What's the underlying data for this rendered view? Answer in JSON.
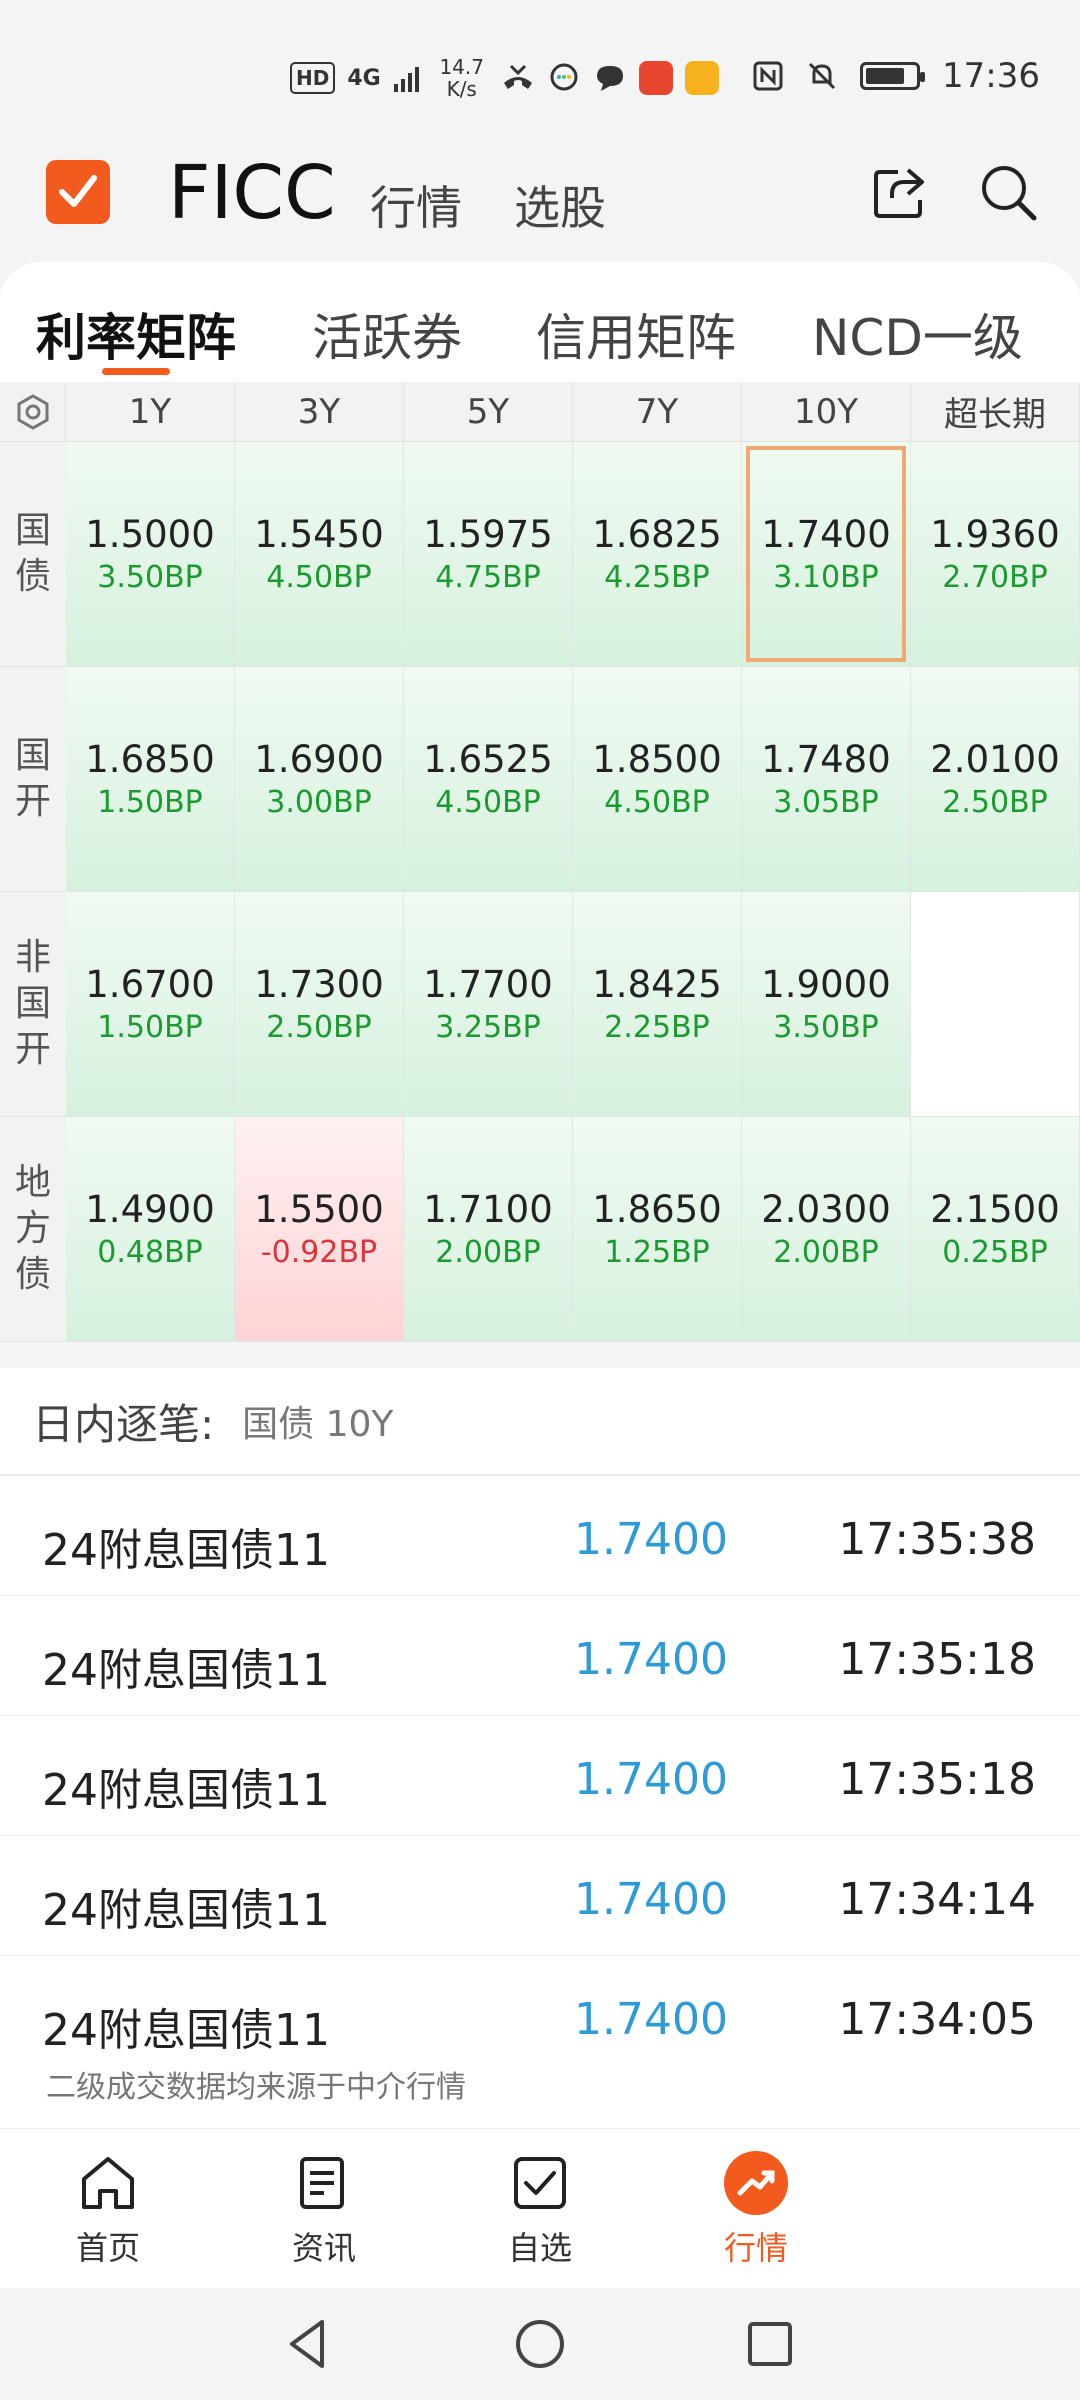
{
  "status_bar": {
    "hd_badge": "HD",
    "network": "4G",
    "speed_value": "14.7",
    "speed_unit": "K/s",
    "time": "17:36",
    "battery_level": 0.8
  },
  "header": {
    "app_title": "FICC",
    "nav": [
      "行情",
      "选股"
    ],
    "accent_color": "#f25a1e"
  },
  "tabs": [
    "利率矩阵",
    "活跃券",
    "信用矩阵",
    "NCD一级"
  ],
  "matrix": {
    "columns": [
      "1Y",
      "3Y",
      "5Y",
      "7Y",
      "10Y",
      "超长期"
    ],
    "rows": [
      {
        "label": "国债",
        "cells": [
          {
            "value": "1.5000",
            "change": "3.50BP"
          },
          {
            "value": "1.5450",
            "change": "4.50BP"
          },
          {
            "value": "1.5975",
            "change": "4.75BP"
          },
          {
            "value": "1.6825",
            "change": "4.25BP"
          },
          {
            "value": "1.7400",
            "change": "3.10BP"
          },
          {
            "value": "1.9360",
            "change": "2.70BP"
          }
        ]
      },
      {
        "label": "国开",
        "cells": [
          {
            "value": "1.6850",
            "change": "1.50BP"
          },
          {
            "value": "1.6900",
            "change": "3.00BP"
          },
          {
            "value": "1.6525",
            "change": "4.50BP"
          },
          {
            "value": "1.8500",
            "change": "4.50BP"
          },
          {
            "value": "1.7480",
            "change": "3.05BP"
          },
          {
            "value": "2.0100",
            "change": "2.50BP"
          }
        ]
      },
      {
        "label": "非国开",
        "cells": [
          {
            "value": "1.6700",
            "change": "1.50BP"
          },
          {
            "value": "1.7300",
            "change": "2.50BP"
          },
          {
            "value": "1.7700",
            "change": "3.25BP"
          },
          {
            "value": "1.8425",
            "change": "2.25BP"
          },
          {
            "value": "1.9000",
            "change": "3.50BP"
          },
          {
            "value": "",
            "change": ""
          }
        ]
      },
      {
        "label": "地方债",
        "cells": [
          {
            "value": "1.4900",
            "change": "0.48BP"
          },
          {
            "value": "1.5500",
            "change": "-0.92BP"
          },
          {
            "value": "1.7100",
            "change": "2.00BP"
          },
          {
            "value": "1.8650",
            "change": "1.25BP"
          },
          {
            "value": "2.0300",
            "change": "2.00BP"
          },
          {
            "value": "2.1500",
            "change": "0.25BP"
          }
        ]
      }
    ]
  },
  "intraday": {
    "title": "日内逐笔:",
    "selected": "国债 10Y",
    "trades": [
      {
        "name": "24附息国债11",
        "price": "1.7400",
        "time": "17:35:38"
      },
      {
        "name": "24附息国债11",
        "price": "1.7400",
        "time": "17:35:18"
      },
      {
        "name": "24附息国债11",
        "price": "1.7400",
        "time": "17:35:18"
      },
      {
        "name": "24附息国债11",
        "price": "1.7400",
        "time": "17:34:14"
      },
      {
        "name": "24附息国债11",
        "price": "1.7400",
        "time": "17:34:05"
      }
    ],
    "disclaimer": "二级成交数据均来源于中介行情"
  },
  "bottom_nav": [
    {
      "label": "首页",
      "icon": "home-icon"
    },
    {
      "label": "资讯",
      "icon": "news-icon"
    },
    {
      "label": "自选",
      "icon": "watchlist-icon"
    },
    {
      "label": "行情",
      "icon": "market-icon"
    }
  ]
}
